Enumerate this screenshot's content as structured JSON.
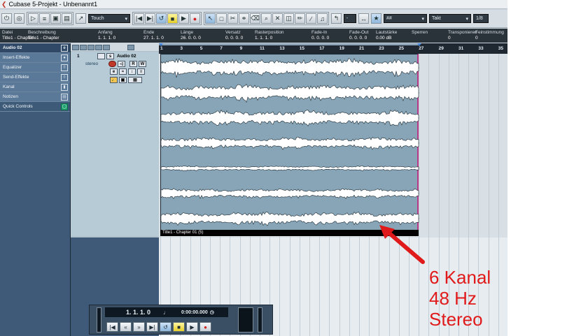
{
  "window": {
    "title": "Cubase 5-Projekt - Unbenannt1"
  },
  "toolbar": {
    "mode_select": "Touch",
    "quantize_icon": "##",
    "grid_type": "Takt",
    "quantize_value": "1/8",
    "tool_icons": [
      "pointer-icon",
      "range-icon",
      "split-icon",
      "glue-icon",
      "erase-icon",
      "zoom-icon",
      "mute-icon",
      "time-warp-icon",
      "draw-icon",
      "line-icon",
      "play-icon",
      "color-icon"
    ]
  },
  "infoline": {
    "columns": [
      {
        "label": "Datei",
        "value": "Title1 - Chapter"
      },
      {
        "label": "Beschreibung",
        "value": "Title1 - Chapter"
      },
      {
        "label": "Anfang",
        "value": "1. 1. 1. 0"
      },
      {
        "label": "Ende",
        "value": "27. 1. 1. 0"
      },
      {
        "label": "Länge",
        "value": "26. 0. 0. 0"
      },
      {
        "label": "Versatz",
        "value": "0. 0. 0. 0"
      },
      {
        "label": "Rasterposition",
        "value": "1. 1. 1. 0"
      },
      {
        "label": "Fade-In",
        "value": "0. 0. 0. 0"
      },
      {
        "label": "Fade-Out",
        "value": "0. 0. 0. 0"
      },
      {
        "label": "Lautstärke",
        "value": "0.00 dB"
      },
      {
        "label": "Sperren",
        "value": ""
      },
      {
        "label": "Transponieren",
        "value": "0"
      },
      {
        "label": "Feinstimmung",
        "value": "0"
      }
    ]
  },
  "inspector": {
    "track_name": "Audio 02",
    "sections": [
      {
        "label": "Insert-Effekte",
        "icon": "insert-icon"
      },
      {
        "label": "Equalizer",
        "icon": "eq-icon"
      },
      {
        "label": "Send-Effekte",
        "icon": "send-icon"
      },
      {
        "label": "Kanal",
        "icon": "channel-icon"
      },
      {
        "label": "Notizen",
        "icon": "notes-icon"
      },
      {
        "label": "Quick Controls",
        "icon": "quick-controls-icon"
      }
    ]
  },
  "track": {
    "number": "1",
    "name": "Audio 02",
    "channel": "stereo",
    "buttons": {
      "mute": "m",
      "solo": "s",
      "read": "R",
      "write": "W"
    }
  },
  "ruler": {
    "ticks": [
      "1",
      "3",
      "5",
      "7",
      "9",
      "11",
      "13",
      "15",
      "17",
      "19",
      "21",
      "23",
      "25",
      "27",
      "29",
      "31",
      "33",
      "35"
    ]
  },
  "event": {
    "name": "Title1 - Chapter 01 (5)",
    "lanes": 7
  },
  "transport": {
    "position": "1. 1. 1.   0",
    "time": "0:00:00.000"
  },
  "annotation": {
    "lines": [
      "6 Kanal",
      "48 Hz",
      "Stereo"
    ],
    "color": "#e01a1a"
  }
}
